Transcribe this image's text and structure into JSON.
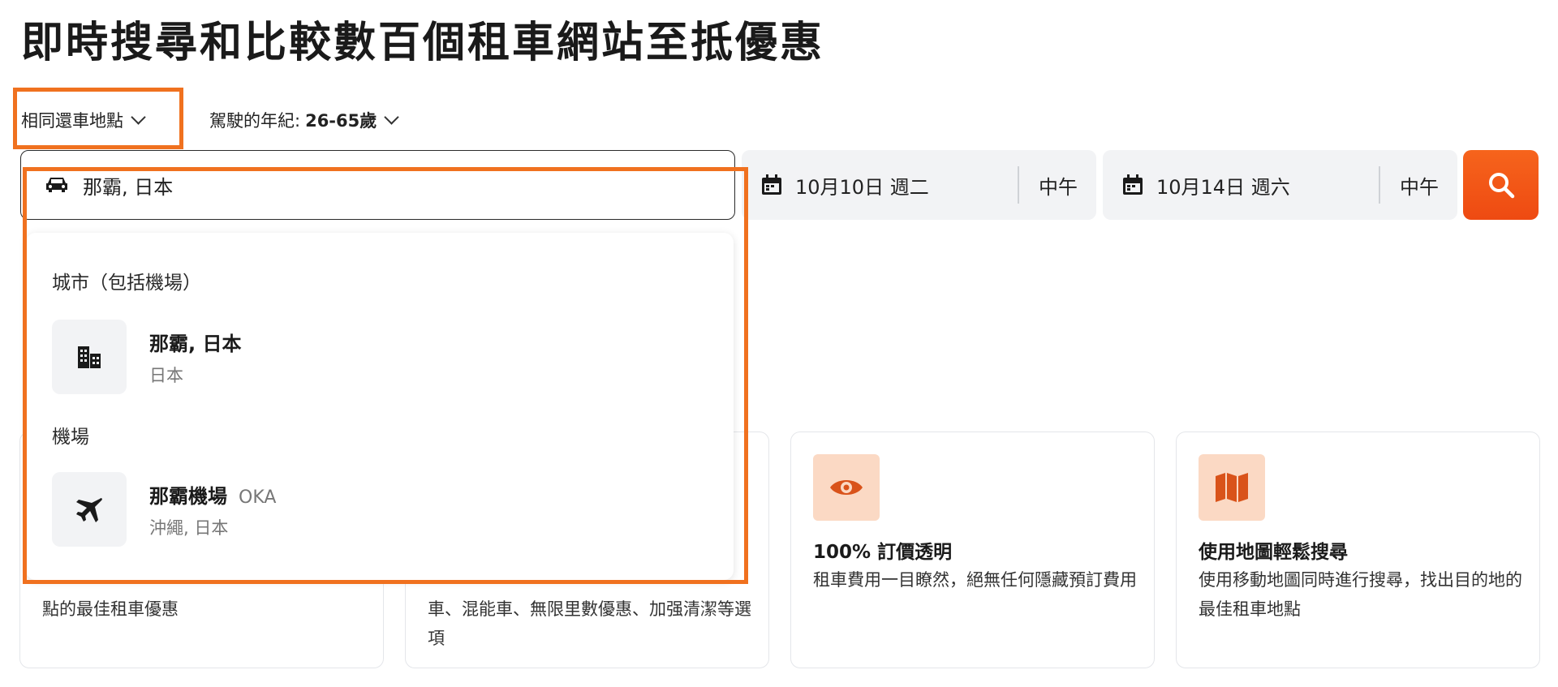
{
  "page": {
    "title": "即時搜尋和比較數百個租車網站至抵優惠"
  },
  "options": {
    "same_return": "相同還車地點",
    "age_label": "駕駛的年紀:",
    "age_value": "26-65歲"
  },
  "search": {
    "location_value": "那霸, 日本",
    "pickup_date": "10月10日 週二",
    "pickup_time": "中午",
    "dropoff_date": "10月14日 週六",
    "dropoff_time": "中午"
  },
  "dropdown": {
    "city_header": "城市（包括機場）",
    "city_name": "那霸, 日本",
    "city_sub": "日本",
    "airport_header": "機場",
    "airport_name": "那霸機場",
    "airport_code": "OKA",
    "airport_sub": "沖繩, 日本"
  },
  "cards": [
    {
      "title": "",
      "desc": "點的最佳租車優惠"
    },
    {
      "title": "",
      "desc": "車、混能車、無限里數優惠、加强清潔等選項"
    },
    {
      "title": "100% 訂價透明",
      "desc": "租車費用一目瞭然，絕無任何隱藏預訂費用"
    },
    {
      "title": "使用地圖輕鬆搜尋",
      "desc": "使用移動地圖同時進行搜尋，找出目的地的最佳租車地點"
    }
  ],
  "icons": {
    "car": "car-icon",
    "calendar": "calendar-icon",
    "search": "search-icon",
    "city": "city-buildings-icon",
    "airport": "airplane-icon",
    "eye": "eye-icon",
    "map": "map-icon"
  },
  "colors": {
    "accent": "#f0711f",
    "search_button": "#ee4a12",
    "icon_tile": "#fbd9c4",
    "icon_fill": "#d9531a"
  }
}
